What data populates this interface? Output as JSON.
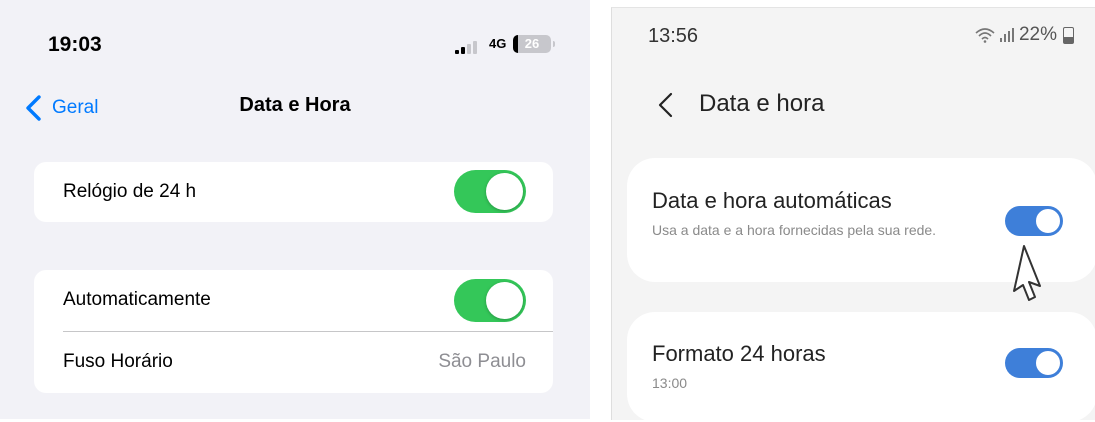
{
  "ios": {
    "status_bar": {
      "time": "19:03",
      "network": "4G",
      "battery": "26",
      "signal_icon": "signal-bars-icon",
      "battery_icon": "battery-icon"
    },
    "nav": {
      "back_label": "Geral",
      "back_icon": "chevron-left-icon",
      "title": "Data e Hora"
    },
    "section1": {
      "row_label": "Relógio de 24 h",
      "toggle_on": true
    },
    "section2": {
      "rows": [
        {
          "label": "Automaticamente",
          "toggle_on": true
        },
        {
          "label": "Fuso Horário",
          "value": "São Paulo"
        }
      ]
    },
    "colors": {
      "accent": "#007aff",
      "switch_on": "#34c759",
      "background": "#f2f2f7"
    }
  },
  "android": {
    "status_bar": {
      "time": "13:56",
      "battery": "22%",
      "wifi_icon": "wifi-icon",
      "signal_icon": "signal-bars-icon",
      "battery_icon": "battery-icon"
    },
    "header": {
      "title": "Data e hora",
      "back_icon": "back-arrow-icon"
    },
    "items": [
      {
        "title": "Data e hora automáticas",
        "subtitle": "Usa a data e a hora fornecidas pela sua rede.",
        "toggle_on": true
      },
      {
        "title": "Formato 24 horas",
        "subtitle": "13:00",
        "toggle_on": true
      }
    ],
    "cursor_icon": "mouse-pointer-icon",
    "colors": {
      "switch_on": "#3e7fd9",
      "background": "#f4f4f4"
    }
  }
}
